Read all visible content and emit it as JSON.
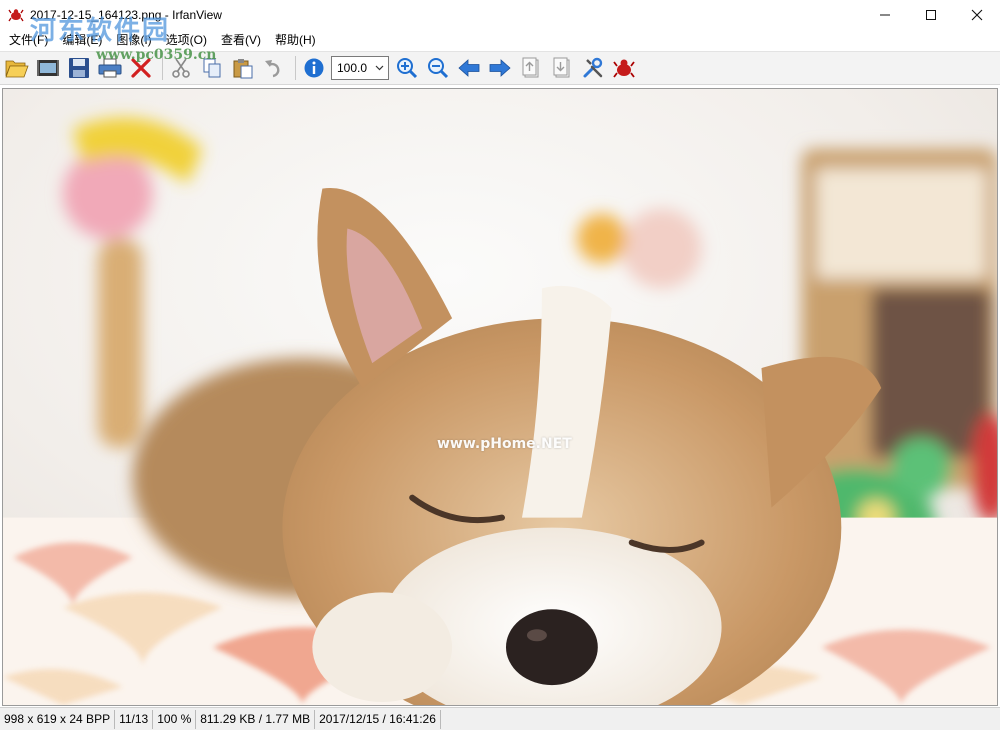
{
  "window": {
    "title": "2017-12-15_164123.png - IrfanView",
    "controls": {
      "minimize": "─",
      "maximize": "☐",
      "close": "✕"
    }
  },
  "menu": {
    "items": [
      {
        "label": "文件(F)"
      },
      {
        "label": "编辑(E)"
      },
      {
        "label": "图像(I)"
      },
      {
        "label": "选项(O)"
      },
      {
        "label": "查看(V)"
      },
      {
        "label": "帮助(H)"
      }
    ]
  },
  "toolbar": {
    "zoom_value": "100.0",
    "icons": [
      "folder-open-icon",
      "slideshow-icon",
      "save-icon",
      "print-icon",
      "delete-icon",
      "cut-icon",
      "copy-icon",
      "paste-icon",
      "undo-icon",
      "info-icon",
      "zoom-in-icon",
      "zoom-out-icon",
      "previous-icon",
      "next-icon",
      "first-page-icon",
      "last-page-icon",
      "settings-icon",
      "irfanview-icon"
    ]
  },
  "watermarks": {
    "site": "河东软件园",
    "url": "www.pc0359.cn",
    "image_mark": "www.pHome.NET"
  },
  "statusbar": {
    "dimensions": "998 x 619 x 24 BPP",
    "file_index": "11/13",
    "zoom": "100 %",
    "size": "811.29 KB / 1.77 MB",
    "datetime": "2017/12/15 / 16:41:26"
  },
  "colors": {
    "accent_blue": "#1f6fd1",
    "delete_red": "#d22020",
    "window_bg": "#ffffff",
    "toolbar_bg": "#f3f3f3"
  }
}
